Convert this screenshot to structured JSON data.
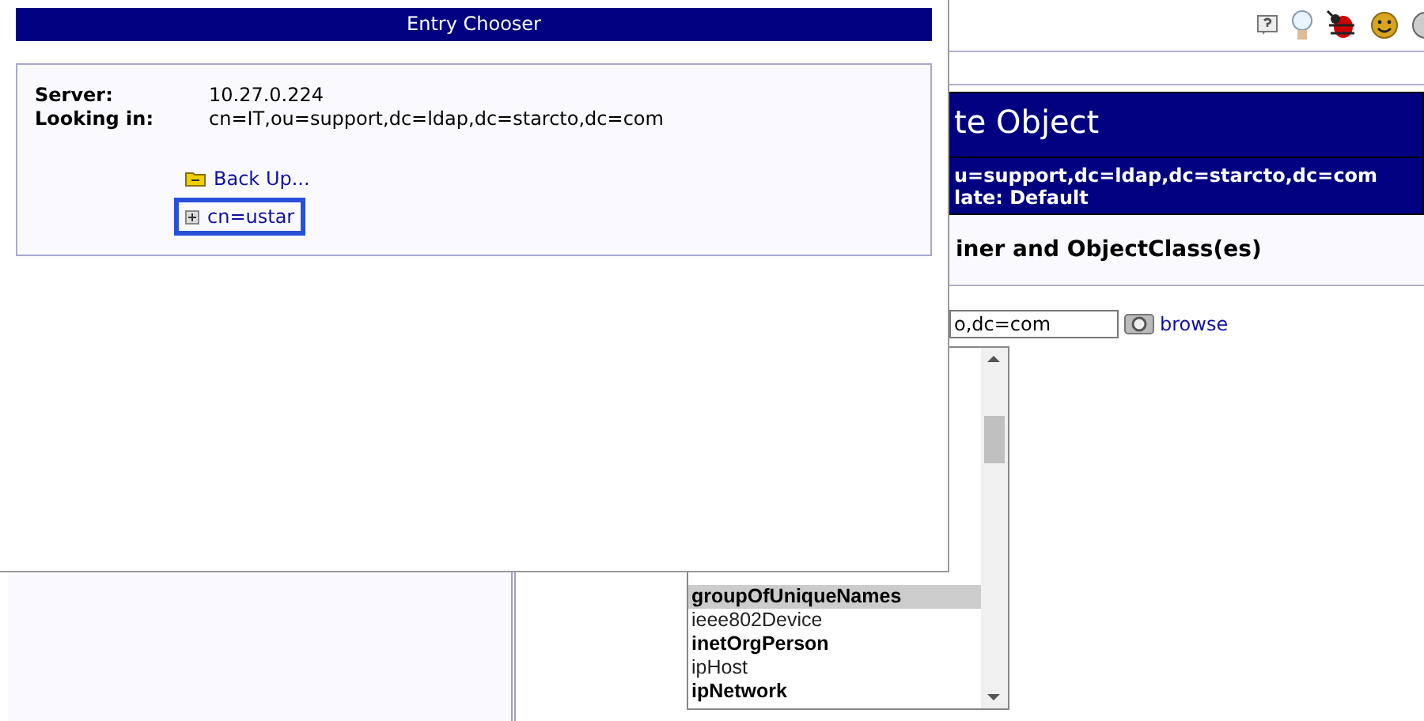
{
  "page": {
    "header_title": "te Object",
    "header_line1": "u=support,dc=ldap,dc=starcto,dc=com",
    "header_line2": "late: Default",
    "section_title": "iner and ObjectClass(es)",
    "container_value": "o,dc=com",
    "browse_link": "browse",
    "objectclasses": [
      {
        "label": "groupOfUniqueNames",
        "structural": true,
        "selected": true
      },
      {
        "label": "ieee802Device",
        "structural": false,
        "selected": false
      },
      {
        "label": "inetOrgPerson",
        "structural": true,
        "selected": false
      },
      {
        "label": "ipHost",
        "structural": false,
        "selected": false
      },
      {
        "label": "ipNetwork",
        "structural": true,
        "selected": false
      }
    ]
  },
  "popup": {
    "title": "Entry Chooser",
    "server_label": "Server:",
    "server": "10.27.0.224",
    "looking_label": "Looking in:",
    "looking_in": "cn=IT,ou=support,dc=ldap,dc=starcto,dc=com",
    "entries": [
      {
        "kind": "back",
        "label": "Back Up...",
        "focused": false
      },
      {
        "kind": "node",
        "label": "cn=ustar",
        "focused": true
      }
    ]
  }
}
